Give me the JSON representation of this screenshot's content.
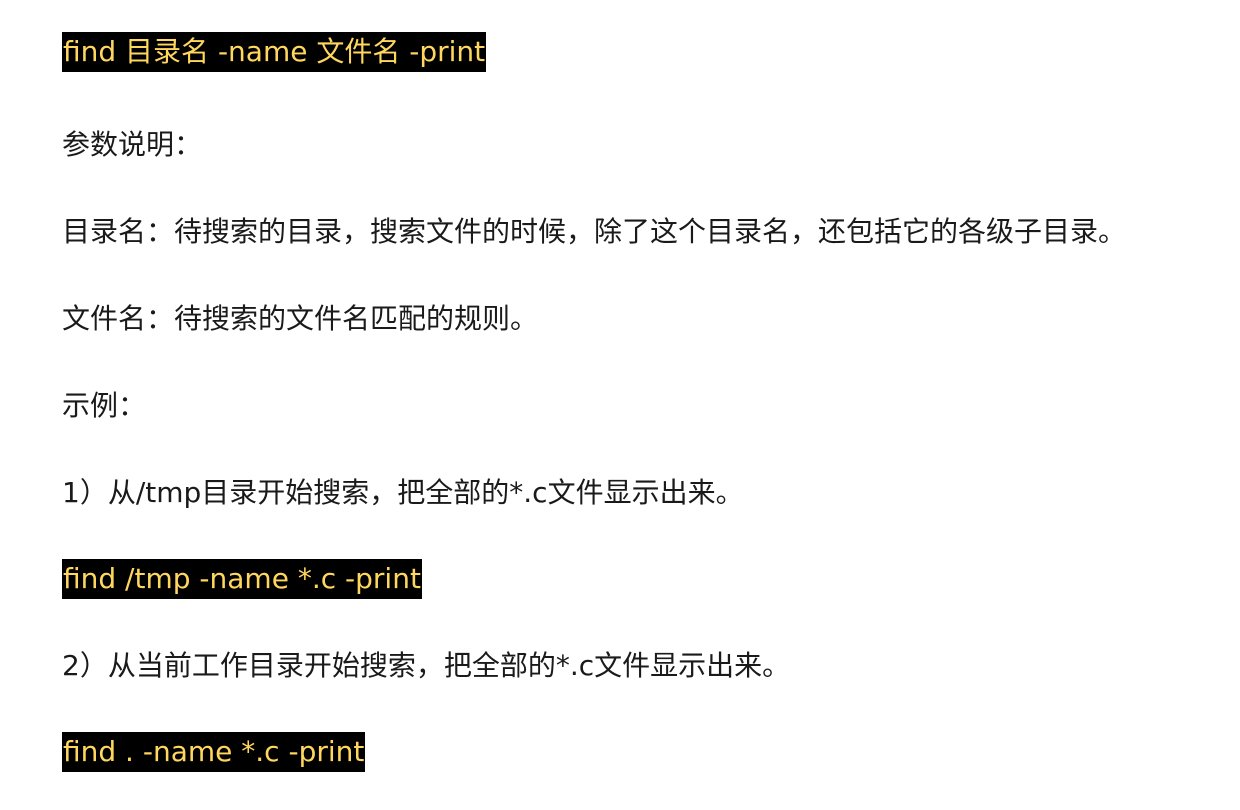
{
  "document": {
    "lines": [
      {
        "kind": "code",
        "text": "find 目录名 -name 文件名 -print"
      },
      {
        "kind": "text",
        "text": "参数说明："
      },
      {
        "kind": "text",
        "text": "目录名：待搜索的目录，搜索文件的时候，除了这个目录名，还包括它的各级子目录。"
      },
      {
        "kind": "text",
        "text": "文件名：待搜索的文件名匹配的规则。"
      },
      {
        "kind": "text",
        "text": "示例："
      },
      {
        "kind": "text",
        "text": "1）从/tmp目录开始搜索，把全部的*.c文件显示出来。"
      },
      {
        "kind": "code",
        "text": "find /tmp -name *.c -print"
      },
      {
        "kind": "text",
        "text": "2）从当前工作目录开始搜索，把全部的*.c文件显示出来。"
      },
      {
        "kind": "code",
        "text": "find . -name *.c -print"
      }
    ]
  },
  "colors": {
    "code_background": "#000000",
    "code_text": "#ffd75e",
    "body_text": "#1a1a1a",
    "page_background": "#ffffff"
  }
}
